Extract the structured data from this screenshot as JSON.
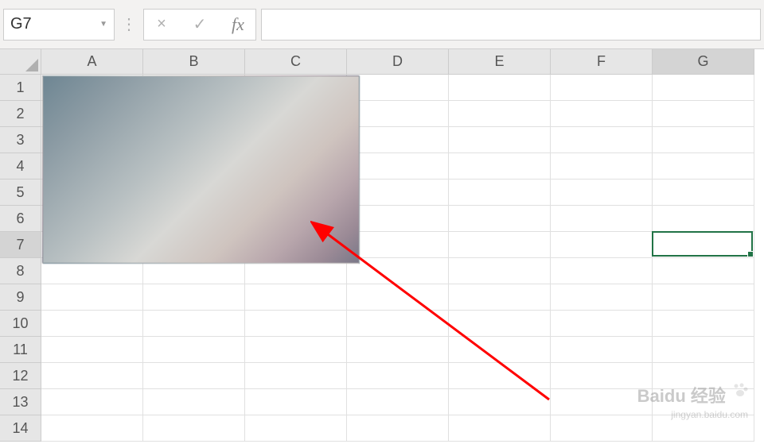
{
  "formula_bar": {
    "name_box": "G7",
    "cancel_icon": "×",
    "enter_icon": "✓",
    "fx_label": "fx",
    "formula_value": ""
  },
  "columns": [
    "A",
    "B",
    "C",
    "D",
    "E",
    "F",
    "G"
  ],
  "rows": [
    "1",
    "2",
    "3",
    "4",
    "5",
    "6",
    "7",
    "8",
    "9",
    "10",
    "11",
    "12",
    "13",
    "14"
  ],
  "active_cell": "G7",
  "active_column_index": 6,
  "active_row_index": 6,
  "colors": {
    "selection_border": "#217346",
    "header_bg": "#e6e6e6",
    "header_active_bg": "#d4d4d4"
  },
  "watermark": {
    "main": "Baidu 经验",
    "sub": "jingyan.baidu.com"
  }
}
